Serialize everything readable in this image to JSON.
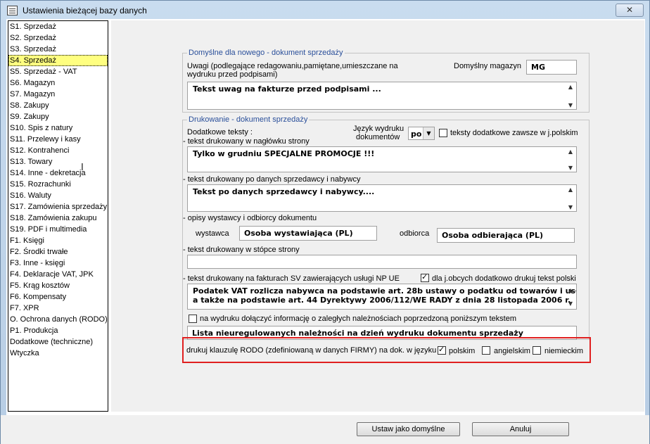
{
  "window": {
    "title": "Ustawienia bieżącej bazy danych",
    "close_label": "✕"
  },
  "sidebar": {
    "items": [
      "S1. Sprzedaż",
      "S2. Sprzedaż",
      "S3. Sprzedaż",
      "S4. Sprzedaż",
      "S5. Sprzedaż - VAT",
      "S6. Magazyn",
      "S7. Magazyn",
      "S8. Zakupy",
      "S9. Zakupy",
      "S10. Spis z natury",
      "S11. Przelewy i kasy",
      "S12. Kontrahenci",
      "S13. Towary",
      "S14. Inne - dekretacja",
      "S15. Rozrachunki",
      "S16. Waluty",
      "S17. Zamówienia sprzedaży",
      "S18. Zamówienia zakupu",
      "S19. PDF i multimedia",
      "F1. Księgi",
      "F2. Środki trwałe",
      "F3. Inne - księgi",
      "F4. Deklaracje VAT, JPK",
      "F5. Krąg kosztów",
      "F6. Kompensaty",
      "F7. XPR",
      "O. Ochrona danych (RODO)",
      "P1. Produkcja",
      "Dodatkowe (techniczne)",
      "Wtyczka"
    ],
    "selected_index": 3
  },
  "defaults_group": {
    "legend": "Domyślne dla nowego - dokument sprzedaży",
    "notes_label_1": "Uwagi (podlegające redagowaniu,pamiętane,umieszczane na",
    "notes_label_2": "wydruku przed podpisami)",
    "warehouse_label": "Domyślny magazyn",
    "warehouse_value": "MG",
    "notes_value": "Tekst uwag na fakturze przed podpisami ..."
  },
  "print_group": {
    "legend": "Drukowanie - dokument sprzedaży",
    "extra_texts_label": "Dodatkowe teksty :",
    "language_label_1": "Język wydruku",
    "language_label_2": "dokumentów",
    "language_value": "po",
    "always_polish_label": "teksty dodatkowe zawsze w j.polskim",
    "always_polish_checked": false,
    "header_label": "- tekst drukowany w nagłówku strony",
    "header_value": "Tylko w grudniu SPECJALNE PROMOCJE !!!",
    "after_parties_label": "- tekst drukowany po danych sprzedawcy i nabywcy",
    "after_parties_value": "Tekst po danych sprzedawcy i nabywcy....",
    "issuer_receiver_label": "- opisy wystawcy i odbiorcy dokumentu",
    "issuer_label": "wystawca",
    "issuer_value": "Osoba wystawiająca (PL)",
    "receiver_label": "odbiorca",
    "receiver_value": "Osoba odbierająca (PL)",
    "footer_label": "- tekst drukowany w stópce strony",
    "footer_value": "",
    "np_ue_label": "- tekst drukowany na fakturach SV zawierających usługi NP UE",
    "foreign_polish_label": "dla j.obcych dodatkowo drukuj tekst polski",
    "foreign_polish_checked": true,
    "np_ue_line1": "Podatek VAT rozlicza nabywca na podstawie art. 28b ustawy o podatku od towarów i usług,",
    "np_ue_line2": "a także na podstawie art. 44 Dyrektywy 2006/112/WE RADY z dnia 28 listopada 2006 r.",
    "overdue_label": "na wydruku dołączyć informację o zaległych należnościach poprzedzoną poniższym tekstem",
    "overdue_checked": false,
    "overdue_value": "Lista nieuregulowanych należności na dzień wydruku dokumentu sprzedaży"
  },
  "rodo": {
    "label": "drukuj klauzulę RODO (zdefiniowaną w  danych FIRMY) na dok. w języku",
    "options": [
      {
        "label": "polskim",
        "checked": true
      },
      {
        "label": "angielskim",
        "checked": false
      },
      {
        "label": "niemieckim",
        "checked": false
      }
    ]
  },
  "buttons": {
    "set_default": "Ustaw jako domyślne",
    "cancel": "Anuluj"
  }
}
